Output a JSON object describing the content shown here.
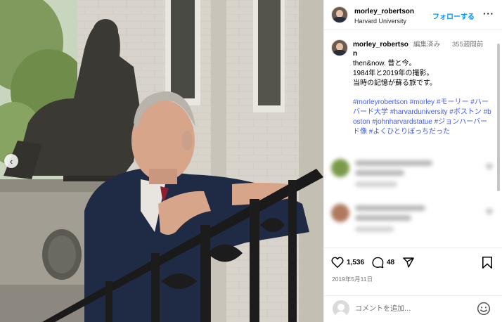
{
  "post": {
    "username": "morley_robertson",
    "location": "Harvard University",
    "follow_label": "フォローする",
    "more_label": "···"
  },
  "caption": {
    "username": "morley_robertson",
    "edited": "編集済み",
    "time": "355週間前",
    "lines": [
      "then&now. 昔と今。",
      "1984年と2019年の撮影。",
      "当時の記憶が蘇る旅です。"
    ],
    "hashtags": "#morleyrobertson #morley #モーリー #ハーバード大学 #harvarduniversity #ボストン #boston #johnharvardstatue #ジョンハーバード像 #よくひとりぼっちだった"
  },
  "actions": {
    "like_icon": "heart-icon",
    "like_count": "1,536",
    "comment_icon": "comment-bubble-icon",
    "comment_count": "48",
    "share_icon": "send-icon",
    "save_icon": "bookmark-icon"
  },
  "date": "2019年5月11日",
  "add_comment": {
    "placeholder": "コメントを追加...",
    "emoji_icon": "emoji-icon"
  },
  "colors": {
    "link": "#0095f6",
    "hashtag": "#3d5afe",
    "muted": "#737373"
  }
}
